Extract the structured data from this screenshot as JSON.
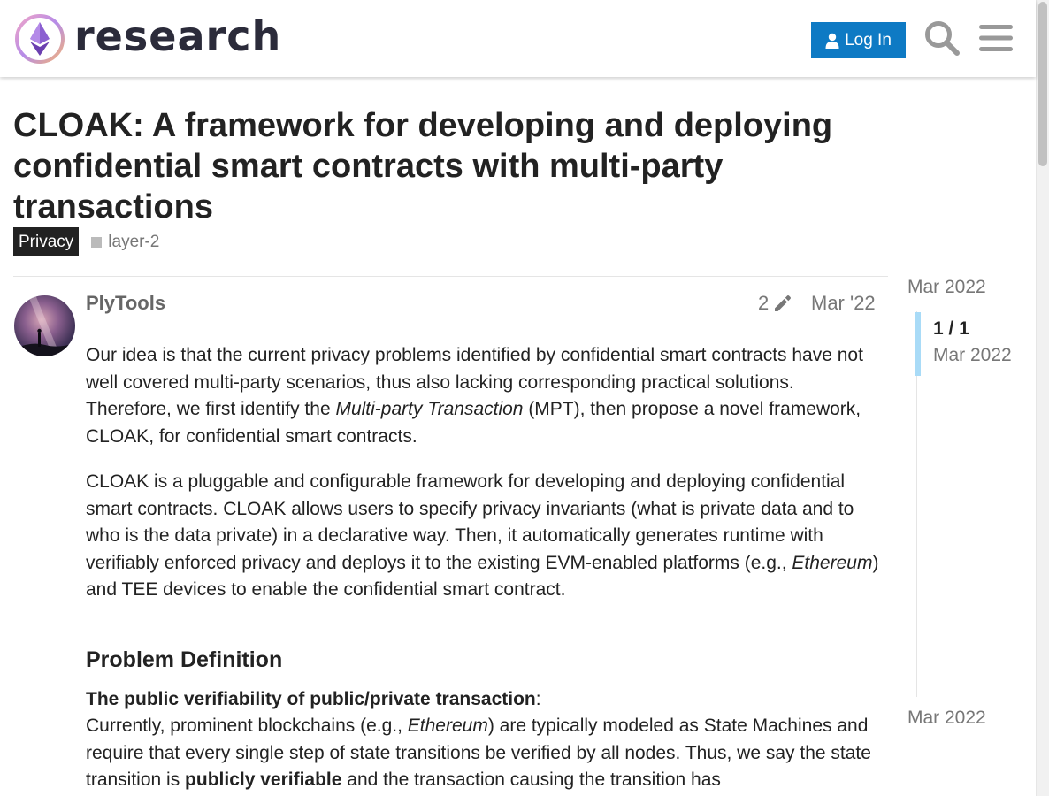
{
  "header": {
    "site_name": "research",
    "login_label": "Log In",
    "icons": [
      "ethereum-research-logo",
      "user-icon",
      "search-icon",
      "hamburger-menu-icon"
    ]
  },
  "topic": {
    "title": "CLOAK: A framework for developing and deploying confidential smart contracts with multi-party transactions",
    "category": "Privacy",
    "tags": [
      "layer-2"
    ]
  },
  "post": {
    "username": "PlyTools",
    "edit_count": "2",
    "date": "Mar '22",
    "p1": {
      "t1": "Our idea is that the current privacy problems identified by confidential smart contracts have not well covered multi-party scenarios, thus also lacking corresponding practical solutions. Therefore, we first identify the ",
      "em1": "Multi-party Transaction",
      "t2": " (MPT), then propose a novel framework, CLOAK, for confidential smart contracts."
    },
    "p2": {
      "t1": "CLOAK is a pluggable and configurable framework for developing and deploying confidential smart contracts. CLOAK allows users to specify privacy invariants (what is private data and to who is the data private) in a declarative way. Then, it automatically generates runtime with verifiably enforced privacy and deploys it to the existing EVM-enabled platforms (e.g., ",
      "em1": "Ethereum",
      "t2": ") and TEE devices to enable the confidential smart contract."
    },
    "h2": "Problem Definition",
    "p3": {
      "strong1": "The public verifiability of public/private transaction",
      "t1": ":",
      "t2": "Currently, prominent blockchains (e.g., ",
      "em1": "Ethereum",
      "t3": ") are typically modeled as State Machines and require that every single step of state transitions be verified by all nodes. Thus, we say the state transition is ",
      "strong2": "publicly verifiable",
      "t4": " and the transaction causing the transition has"
    }
  },
  "timeline": {
    "start_date": "Mar 2022",
    "position": "1 / 1",
    "position_date": "Mar 2022",
    "end_date": "Mar 2022"
  },
  "colors": {
    "primary": "#0e7ac4",
    "category_badge": "#222222",
    "timeline_handle": "#a9dbf7"
  }
}
